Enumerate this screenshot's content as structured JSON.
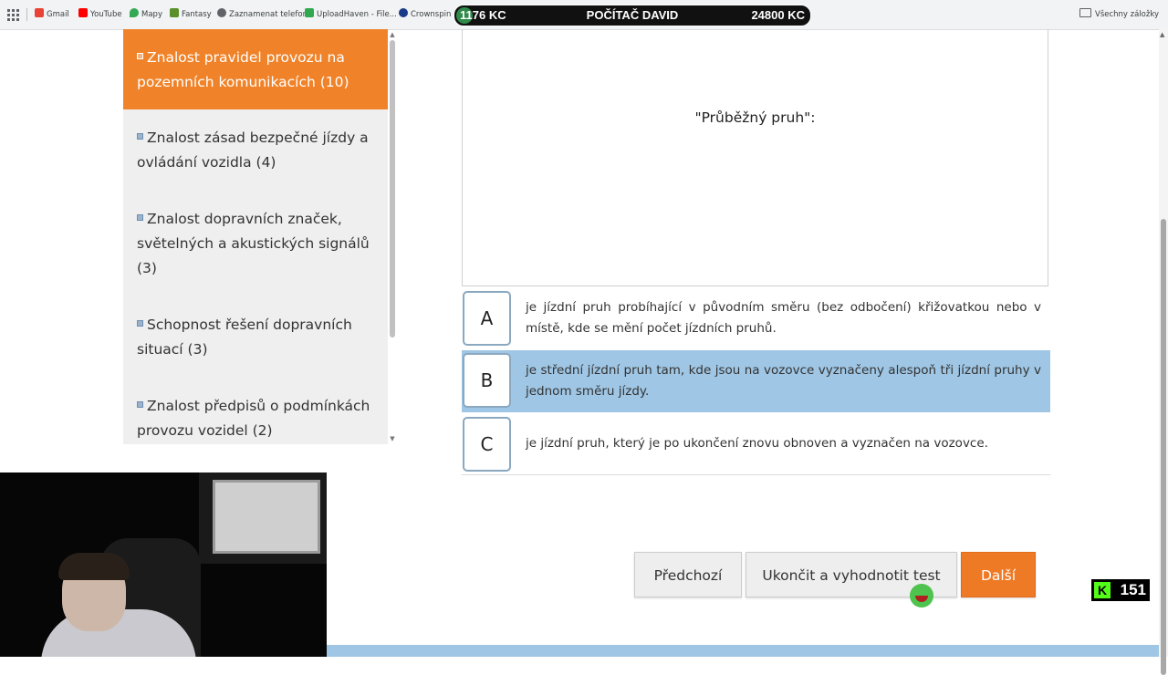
{
  "bookmarks": [
    {
      "label": "Gmail",
      "icon": "gmail-icon",
      "color": "#ea4335"
    },
    {
      "label": "YouTube",
      "icon": "youtube-icon",
      "color": "#ff0000"
    },
    {
      "label": "Mapy",
      "icon": "maps-icon",
      "color": "#34a853"
    },
    {
      "label": "Fantasy",
      "icon": "fantasy-icon",
      "color": "#5a8f29"
    },
    {
      "label": "Zaznamenat telefon",
      "icon": "phone-icon",
      "color": "#5f6368"
    },
    {
      "label": "UploadHaven - File...",
      "icon": "uploadhaven-icon",
      "color": "#2fa84f"
    },
    {
      "label": "Crownspin |",
      "icon": "crownspin-icon",
      "color": "#1a3a8a"
    }
  ],
  "bookmarks_folder": "Všechny záložky",
  "overlay": {
    "left": "1176 KC",
    "center": "POČÍTAČ DAVID",
    "right": "24800 KC"
  },
  "sidebar": {
    "items": [
      {
        "label": "Znalost pravidel provozu na pozemních komunikacích (10)",
        "active": true
      },
      {
        "label": "Znalost zásad bezpečné jízdy a ovládání vozidla (4)",
        "active": false
      },
      {
        "label": "Znalost dopravních značek, světelných a akustických signálů (3)",
        "active": false
      },
      {
        "label": "Schopnost řešení dopravních situací (3)",
        "active": false
      },
      {
        "label": "Znalost předpisů o podmínkách provozu vozidel (2)",
        "active": false
      }
    ]
  },
  "question": {
    "text": "\"Průběžný pruh\":"
  },
  "answers": [
    {
      "letter": "A",
      "text": "je jízdní pruh probíhající v původním směru (bez odbočení) křižovatkou nebo v místě, kde se mění počet jízdních pruhů.",
      "selected": false
    },
    {
      "letter": "B",
      "text": "je střední jízdní pruh tam, kde jsou na vozovce vyznačeny alespoň tři jízdní pruhy v jednom směru jízdy.",
      "selected": true
    },
    {
      "letter": "C",
      "text": "je jízdní pruh, který je po ukončení znovu obnoven a vyznačen na vozovce.",
      "selected": false
    }
  ],
  "buttons": {
    "prev": "Předchozí",
    "finish": "Ukončit a vyhodnotit test",
    "next": "Další"
  },
  "kick": {
    "letter": "K",
    "count": "151"
  },
  "colors": {
    "accent": "#f08329",
    "selected": "#9fc6e4",
    "kick": "#53fc18"
  }
}
